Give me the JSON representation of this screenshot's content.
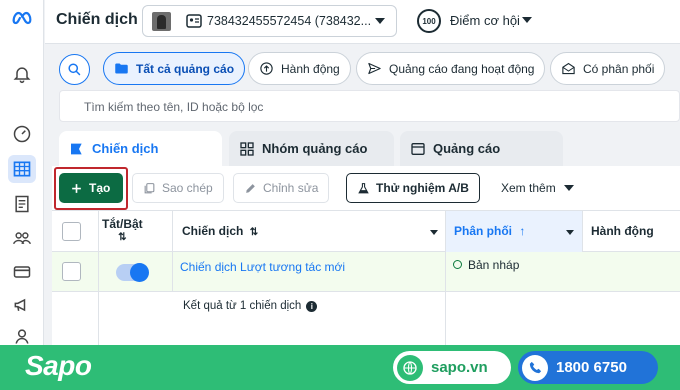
{
  "topbar": {
    "title": "Chiến dịch",
    "account_text": "738432455572454 (738432...",
    "score_value": "100",
    "score_label": "Điểm cơ hội"
  },
  "filters": {
    "chips": [
      {
        "label": "Tất cả quảng cáo",
        "icon": "folder-icon",
        "active": true
      },
      {
        "label": "Hành động",
        "icon": "pointer-icon",
        "active": false
      },
      {
        "label": "Quảng cáo đang hoạt động",
        "icon": "send-icon",
        "active": false
      },
      {
        "label": "Có phân phối",
        "icon": "mail-icon",
        "active": false
      }
    ],
    "search_placeholder": "Tìm kiếm theo tên, ID hoặc bộ lọc"
  },
  "tabs": [
    {
      "label": "Chiến dịch",
      "icon": "campaign-icon",
      "active": true
    },
    {
      "label": "Nhóm quảng cáo",
      "icon": "adset-grid-icon",
      "active": false
    },
    {
      "label": "Quảng cáo",
      "icon": "ad-window-icon",
      "active": false
    }
  ],
  "toolbar": {
    "create_label": "Tạo",
    "duplicate_label": "Sao chép",
    "edit_label": "Chỉnh sửa",
    "ab_test_label": "Thử nghiệm A/B",
    "more_label": "Xem thêm"
  },
  "table": {
    "headers": {
      "toggle": "Tắt/Bật",
      "campaign": "Chiến dịch",
      "delivery": "Phân phối",
      "action": "Hành động"
    },
    "rows": [
      {
        "campaign": "Chiến dịch Lượt tương tác mới",
        "delivery": "Bản nháp",
        "on": true
      }
    ],
    "summary": "Kết quả từ 1 chiến dịch"
  },
  "footer": {
    "brand": "Sapo",
    "website": "sapo.vn",
    "phone": "1800 6750"
  },
  "colors": {
    "accent": "#1877f2",
    "create": "#0c6b43",
    "footer": "#2ebd76",
    "phone_pill": "#2173d8"
  }
}
